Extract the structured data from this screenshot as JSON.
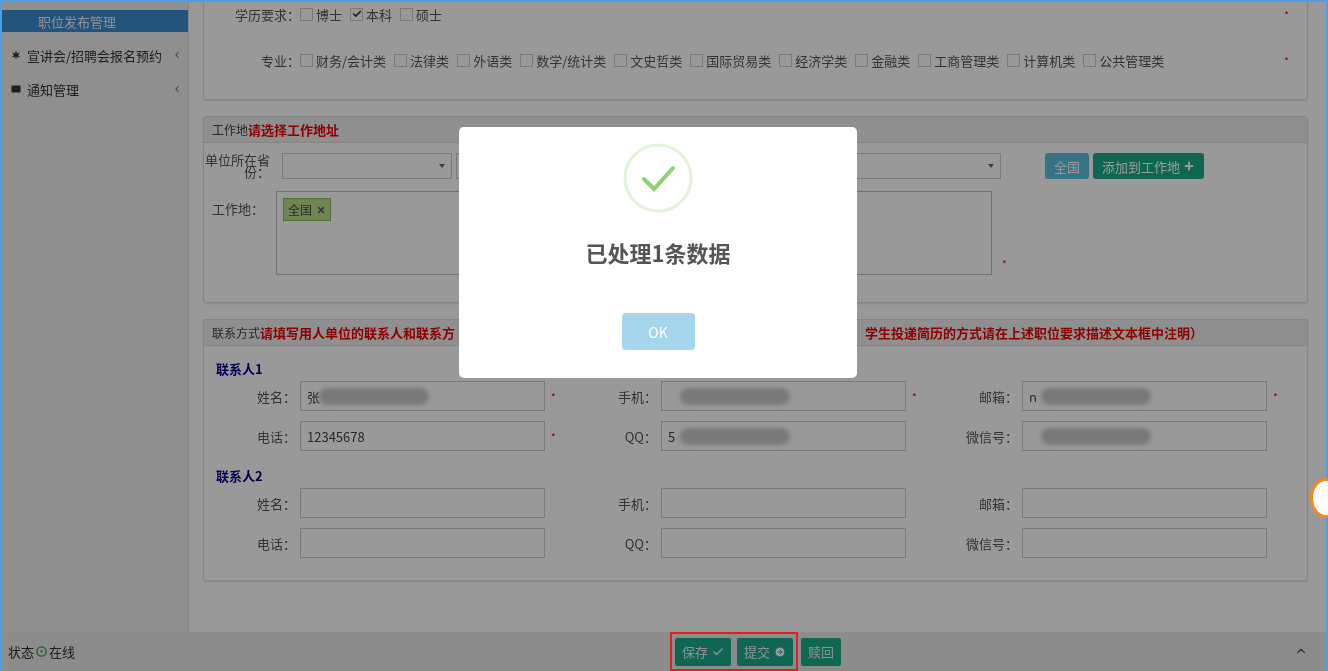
{
  "sidebar": {
    "items": [
      {
        "label": "职位发布管理",
        "selected": true,
        "kind": "plain",
        "expandable": false
      },
      {
        "label": "宣讲会/招聘会报名预约",
        "selected": false,
        "kind": "event",
        "expandable": true
      },
      {
        "label": "通知管理",
        "selected": false,
        "kind": "notice",
        "expandable": true
      }
    ]
  },
  "requirements": {
    "rows": [
      {
        "label": "学历要求：",
        "mark": "*",
        "options": [
          {
            "label": "博士",
            "checked": false
          },
          {
            "label": "本科",
            "checked": true
          },
          {
            "label": "硕士",
            "checked": false
          }
        ]
      },
      {
        "label": "专业：",
        "mark": "*",
        "options": [
          {
            "label": "财务/会计类",
            "checked": false
          },
          {
            "label": "法律类",
            "checked": false
          },
          {
            "label": "外语类",
            "checked": false
          },
          {
            "label": "数学/统计类",
            "checked": false
          },
          {
            "label": "文史哲类",
            "checked": false
          },
          {
            "label": "国际贸易类",
            "checked": false
          },
          {
            "label": "经济学类",
            "checked": false
          },
          {
            "label": "金融类",
            "checked": false
          },
          {
            "label": "工商管理类",
            "checked": false
          },
          {
            "label": "计算机类",
            "checked": false
          },
          {
            "label": "公共管理类",
            "checked": false
          }
        ]
      }
    ]
  },
  "workplace": {
    "title": "工作地",
    "hint": "请选择工作地址",
    "province_label": "单位所在省份：",
    "buttons": [
      {
        "label": "全国",
        "kind": "info"
      },
      {
        "label": "添加到工作地",
        "kind": "add"
      }
    ],
    "workplace_label": "工作地：",
    "tags": [
      {
        "label": "全国"
      }
    ],
    "mark": "*"
  },
  "contact": {
    "title": "联系方式",
    "hint_parts": [
      "请填写用人单位的联系人和联系方",
      "学生投递简历的方式请在上述职位要求描述文本框中注明）"
    ],
    "contacts": [
      {
        "title": "联系人1",
        "fields": [
          {
            "label": "姓名：",
            "value": "张",
            "mark": "*",
            "redacted": true
          },
          {
            "label": "手机：",
            "mark": "*",
            "redacted": true
          },
          {
            "label": "邮箱：",
            "value": "n",
            "mark": "*",
            "redacted": true
          },
          {
            "label": "电话：",
            "value": "12345678",
            "mark": "*",
            "redacted": false
          },
          {
            "label": "QQ：",
            "value": "5",
            "redacted": true
          },
          {
            "label": "微信号：",
            "redacted": true
          }
        ]
      },
      {
        "title": "联系人2",
        "fields": [
          {
            "label": "姓名：",
            "redacted": false
          },
          {
            "label": "手机：",
            "redacted": false
          },
          {
            "label": "邮箱：",
            "redacted": false
          },
          {
            "label": "电话：",
            "redacted": false
          },
          {
            "label": "QQ：",
            "redacted": false
          },
          {
            "label": "微信号：",
            "redacted": false
          }
        ]
      }
    ]
  },
  "status_bar": {
    "label": "状态",
    "status": "在线",
    "online": true
  },
  "actions": [
    {
      "label": "保存",
      "kind": "save",
      "highlighted": true
    },
    {
      "label": "提交",
      "kind": "submit",
      "highlighted": true
    },
    {
      "label": "赎回",
      "kind": "back",
      "highlighted": false
    }
  ],
  "dialog": {
    "kind": "success",
    "message": "已处理1条数据",
    "button": "OK"
  }
}
